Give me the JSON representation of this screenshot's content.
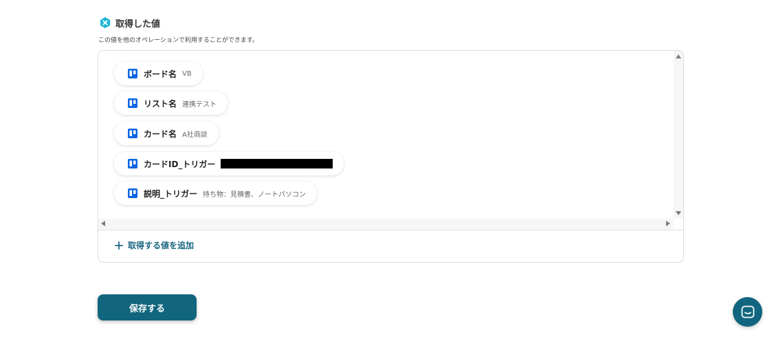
{
  "section": {
    "title": "取得した値",
    "description": "この値を他のオペレーションで利用することができます。"
  },
  "values": [
    {
      "label": "ボード名",
      "value": "VB",
      "icon": "trello-icon"
    },
    {
      "label": "リスト名",
      "value": "連携テスト",
      "icon": "trello-icon"
    },
    {
      "label": "カード名",
      "value": "A社商談",
      "icon": "trello-icon"
    },
    {
      "label": "カードID_トリガー",
      "value": "",
      "redacted": true,
      "icon": "trello-icon"
    },
    {
      "label": "説明_トリガー",
      "value": "持ち物：見積書、ノートパソコン",
      "icon": "trello-icon"
    }
  ],
  "add_value_label": "取得する値を追加",
  "save_label": "保存する",
  "colors": {
    "accent": "#11657e",
    "link": "#1a6783",
    "trello": "#0c66e4",
    "section_icon": "#1fb5d6"
  },
  "icons": {
    "section": "hexagon-x-icon",
    "add": "plus-icon",
    "chat": "chat-bubble-icon"
  }
}
